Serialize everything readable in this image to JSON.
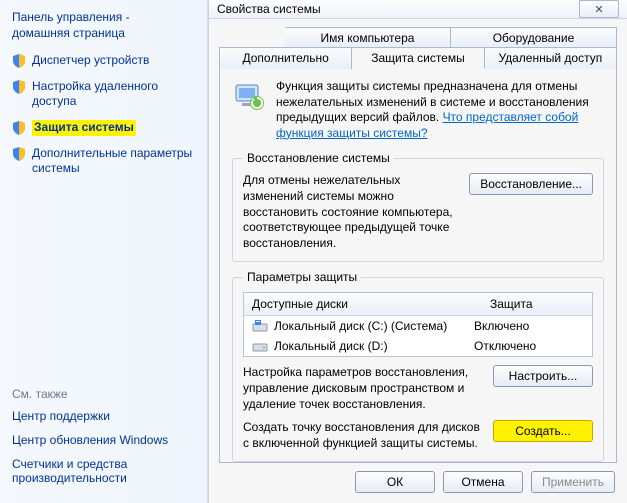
{
  "sidebar": {
    "header_line1": "Панель управления -",
    "header_line2": "домашняя страница",
    "items": [
      {
        "label": "Диспетчер устройств"
      },
      {
        "label": "Настройка удаленного доступа"
      },
      {
        "label": "Защита системы"
      },
      {
        "label": "Дополнительные параметры системы"
      }
    ],
    "see_also_header": "См. также",
    "see_also": [
      {
        "label": "Центр поддержки"
      },
      {
        "label": "Центр обновления Windows"
      },
      {
        "label": "Счетчики и средства производительности"
      }
    ]
  },
  "window": {
    "title": "Свойства системы",
    "close_glyph": "✕"
  },
  "tabs_row1": [
    {
      "label": "Имя компьютера"
    },
    {
      "label": "Оборудование"
    }
  ],
  "tabs_row2": [
    {
      "label": "Дополнительно"
    },
    {
      "label": "Защита системы"
    },
    {
      "label": "Удаленный доступ"
    }
  ],
  "intro": {
    "text": "Функция защиты системы предназначена для отмены нежелательных изменений в системе и восстановления предыдущих версий файлов. ",
    "link": "Что представляет собой функция защиты системы?"
  },
  "restore": {
    "legend": "Восстановление системы",
    "text": "Для отмены нежелательных изменений системы можно восстановить состояние компьютера, соответствующее предыдущей точке восстановления.",
    "button": "Восстановление..."
  },
  "protection": {
    "legend": "Параметры защиты",
    "col_disk": "Доступные диски",
    "col_status": "Защита",
    "disks": [
      {
        "name": "Локальный диск (C:) (Система)",
        "status": "Включено"
      },
      {
        "name": "Локальный диск (D:)",
        "status": "Отключено"
      }
    ],
    "configure_text": "Настройка параметров восстановления, управление дисковым пространством и удаление точек восстановления.",
    "configure_button": "Настроить...",
    "create_text": "Создать точку восстановления для дисков с включенной функцией защиты системы.",
    "create_button": "Создать..."
  },
  "dialog_buttons": {
    "ok": "ОК",
    "cancel": "Отмена",
    "apply": "Применить"
  }
}
